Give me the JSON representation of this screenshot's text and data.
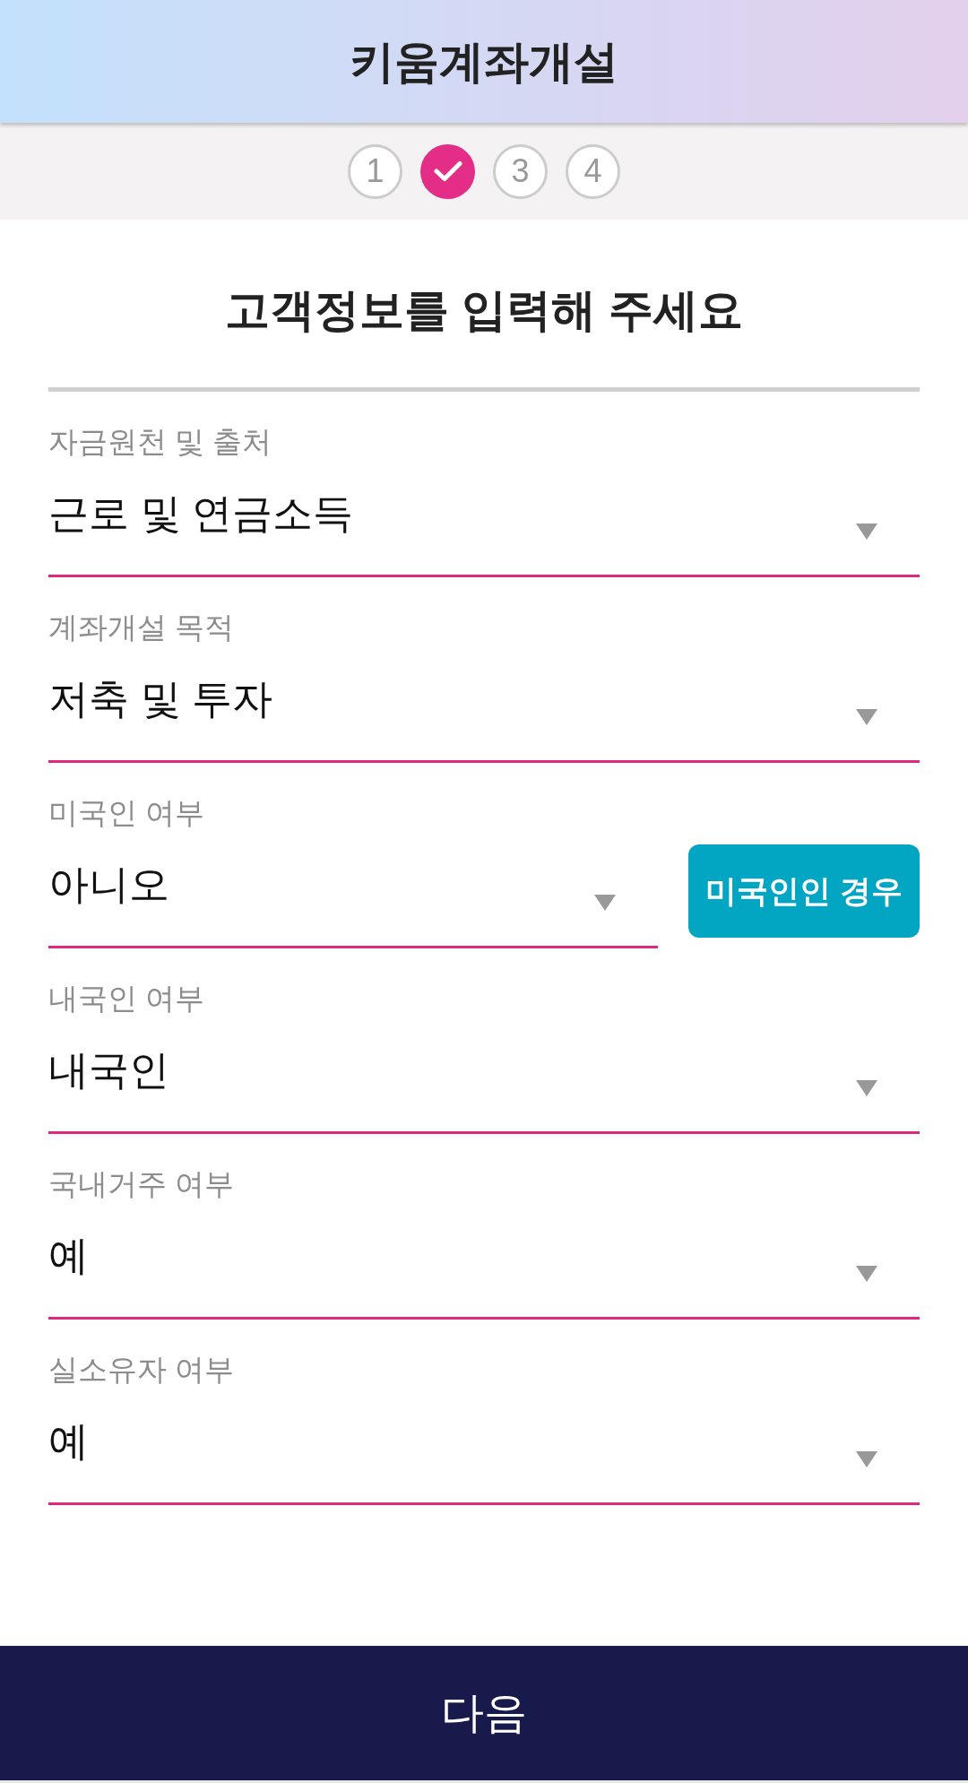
{
  "header": {
    "title": "키움계좌개설"
  },
  "steps": [
    {
      "label": "1",
      "selected": false
    },
    {
      "selected": true
    },
    {
      "label": "3",
      "selected": false
    },
    {
      "label": "4",
      "selected": false
    }
  ],
  "heading": "고객정보를 입력해 주세요",
  "fields": [
    {
      "label": "자금원천 및 출처",
      "value": "근로 및 연금소득"
    },
    {
      "label": "계좌개설 목적",
      "value": "저축 및 투자"
    },
    {
      "label": "미국인 여부",
      "value": "아니오",
      "button": "미국인인 경우"
    },
    {
      "label": "내국인 여부",
      "value": "내국인"
    },
    {
      "label": "국내거주 여부",
      "value": "예"
    },
    {
      "label": "실소유자 여부",
      "value": "예"
    }
  ],
  "next_button": "다음"
}
